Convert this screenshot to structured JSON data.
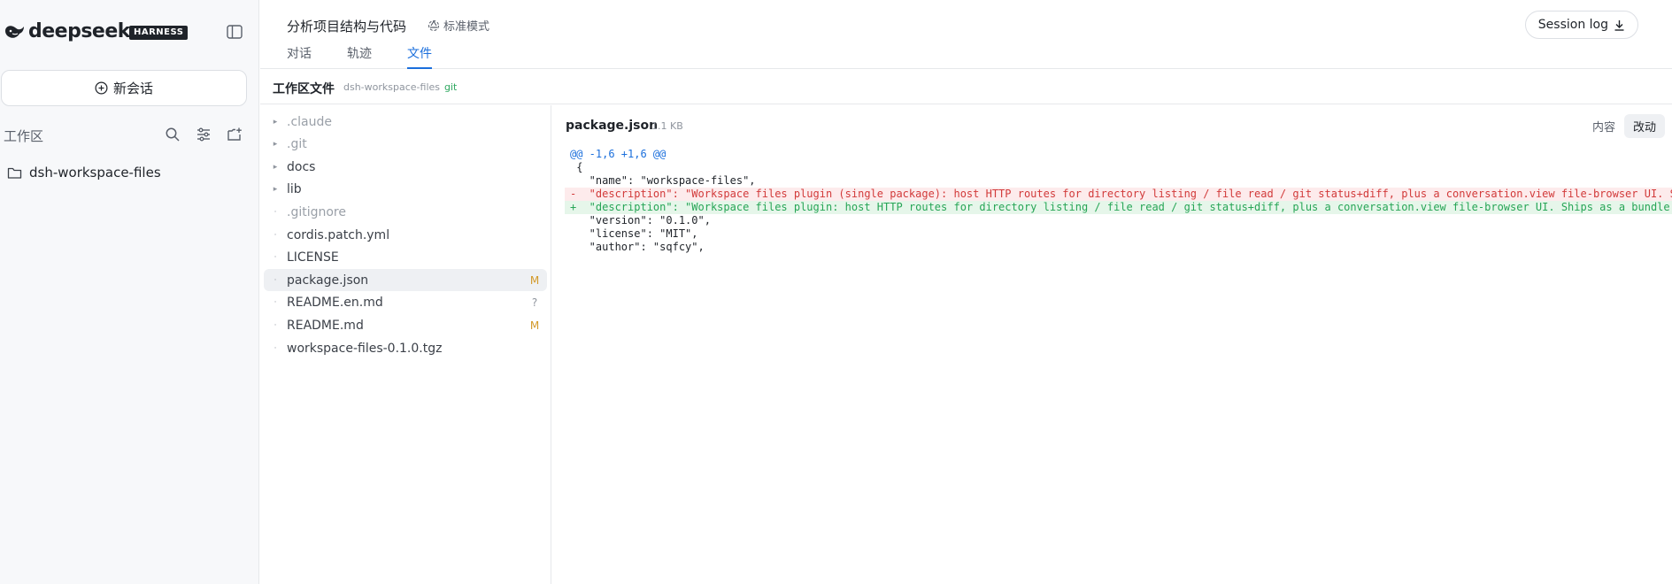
{
  "sidebar": {
    "logo_text": "deepseek",
    "badge": "HARNESS",
    "new_chat_label": "新会话",
    "workspace_label": "工作区",
    "workspace_item": "dsh-workspace-files"
  },
  "header": {
    "session_title": "分析项目结构与代码",
    "mode_label": "标准模式",
    "tabs": [
      "对话",
      "轨迹",
      "文件"
    ],
    "active_tab": "文件",
    "session_log_label": "Session log"
  },
  "files_bar": {
    "title": "工作区文件",
    "folder": "dsh-workspace-files",
    "vcs": "git"
  },
  "tree": [
    {
      "name": ".claude",
      "type": "dir",
      "status": ""
    },
    {
      "name": ".git",
      "type": "dir",
      "status": ""
    },
    {
      "name": "docs",
      "type": "dir",
      "status": ""
    },
    {
      "name": "lib",
      "type": "dir",
      "status": ""
    },
    {
      "name": ".gitignore",
      "type": "file",
      "status": ""
    },
    {
      "name": "cordis.patch.yml",
      "type": "file",
      "status": ""
    },
    {
      "name": "LICENSE",
      "type": "file",
      "status": ""
    },
    {
      "name": "package.json",
      "type": "file",
      "status": "M",
      "selected": true
    },
    {
      "name": "README.en.md",
      "type": "file",
      "status": "?"
    },
    {
      "name": "README.md",
      "type": "file",
      "status": "M"
    },
    {
      "name": "workspace-files-0.1.0.tgz",
      "type": "file",
      "status": ""
    }
  ],
  "viewer": {
    "filename": "package.json",
    "filesize": "1.1 KB",
    "view_content_label": "内容",
    "view_diff_label": "改动",
    "diff": [
      {
        "kind": "hunk",
        "text": "@@ -1,6 +1,6 @@"
      },
      {
        "kind": "ctx",
        "text": " {"
      },
      {
        "kind": "ctx",
        "text": "   \"name\": \"workspace-files\","
      },
      {
        "kind": "del",
        "text": "-  \"description\": \"Workspace files plugin (single package): host HTTP routes for directory listing / file read / git status+diff, plus a conversation.view file-browser UI. Ships"
      },
      {
        "kind": "add",
        "text": "+  \"description\": \"Workspace files plugin: host HTTP routes for directory listing / file read / git status+diff, plus a conversation.view file-browser UI. Ships as a bundle that"
      },
      {
        "kind": "ctx",
        "text": "   \"version\": \"0.1.0\","
      },
      {
        "kind": "ctx",
        "text": "   \"license\": \"MIT\","
      },
      {
        "kind": "ctx",
        "text": "   \"author\": \"sqfcy\","
      }
    ]
  }
}
